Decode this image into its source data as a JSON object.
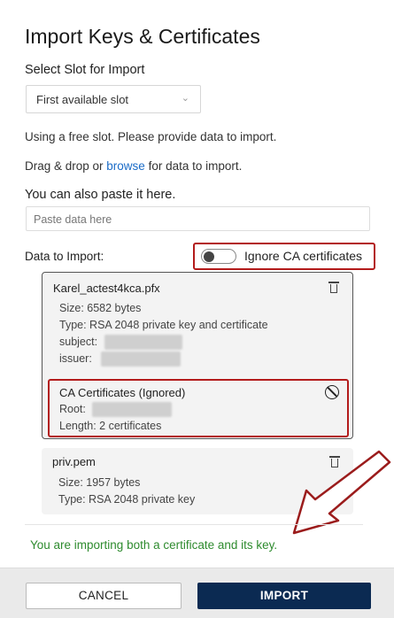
{
  "dialog": {
    "title": "Import Keys & Certificates",
    "slot_label": "Select Slot for Import",
    "slot_selected": "First available slot",
    "free_slot_msg": "Using a free slot. Please provide data to import.",
    "drag_prefix": "Drag & drop or ",
    "browse_link": "browse",
    "drag_suffix": " for data to import.",
    "paste_label": "You can also paste it here.",
    "paste_placeholder": "Paste data here",
    "data_label": "Data to Import:",
    "ignore_ca_label": "Ignore CA certificates",
    "ignore_ca_on": false
  },
  "files": [
    {
      "name": "Karel_actest4kca.pfx",
      "size": "Size: 6582 bytes",
      "type": "Type: RSA 2048 private key and certificate",
      "subject_label": "subject:",
      "issuer_label": "issuer:",
      "ca": {
        "title": "CA Certificates (Ignored)",
        "root_label": "Root:",
        "length": "Length: 2 certificates"
      }
    },
    {
      "name": "priv.pem",
      "size": "Size: 1957 bytes",
      "type": "Type: RSA 2048 private key"
    }
  ],
  "status": {
    "success_msg": "You are importing both a certificate and its key."
  },
  "footer": {
    "cancel_label": "CANCEL",
    "import_label": "IMPORT"
  },
  "colors": {
    "accent": "#0b2a52",
    "highlight": "#b31b1b",
    "success": "#2e8b2e",
    "link": "#1a6bc7"
  }
}
